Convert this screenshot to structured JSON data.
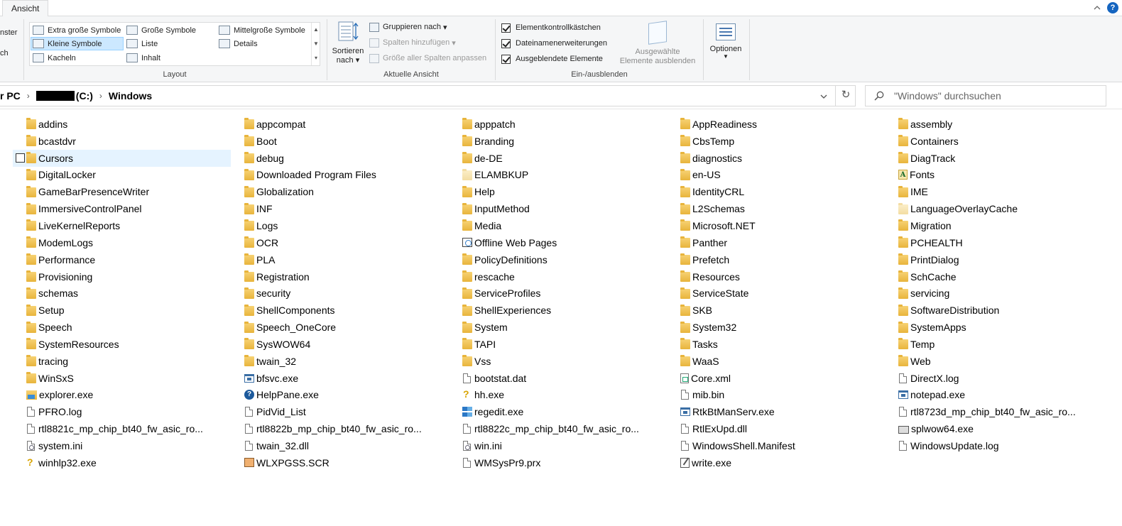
{
  "tabstrip": {
    "active_tab": "Ansicht",
    "help": "?"
  },
  "ribbon": {
    "cut_labels": [
      "nster",
      "ch"
    ],
    "layout": {
      "group_label": "Layout",
      "items": [
        {
          "label": "Extra große Symbole",
          "selected": false
        },
        {
          "label": "Große Symbole",
          "selected": false
        },
        {
          "label": "Mittelgroße Symbole",
          "selected": false
        },
        {
          "label": "Kleine Symbole",
          "selected": true
        },
        {
          "label": "Liste",
          "selected": false
        },
        {
          "label": "Details",
          "selected": false
        },
        {
          "label": "Kacheln",
          "selected": false
        },
        {
          "label": "Inhalt",
          "selected": false
        }
      ]
    },
    "current_view": {
      "group_label": "Aktuelle Ansicht",
      "sort_line1": "Sortieren",
      "sort_line2": "nach",
      "group_by": "Gruppieren nach",
      "add_columns": "Spalten hinzufügen",
      "fit_columns": "Größe aller Spalten anpassen"
    },
    "show_hide": {
      "group_label": "Ein-/ausblenden",
      "checkboxes": [
        {
          "label": "Elementkontrollkästchen",
          "checked": true
        },
        {
          "label": "Dateinamenerweiterungen",
          "checked": true
        },
        {
          "label": "Ausgeblendete Elemente",
          "checked": true
        }
      ],
      "hide_selected_line1": "Ausgewählte",
      "hide_selected_line2": "Elemente ausblenden"
    },
    "options": {
      "label": "Optionen"
    }
  },
  "address": {
    "crumb_pc": "r PC",
    "crumb_drive": "(C:)",
    "crumb_folder": "Windows"
  },
  "search": {
    "placeholder": "\"Windows\" durchsuchen"
  },
  "items": [
    {
      "name": "addins",
      "icon": "folder-icon"
    },
    {
      "name": "appcompat",
      "icon": "folder-icon"
    },
    {
      "name": "apppatch",
      "icon": "folder-icon"
    },
    {
      "name": "AppReadiness",
      "icon": "folder-icon"
    },
    {
      "name": "assembly",
      "icon": "folder-icon"
    },
    {
      "name": "bcastdvr",
      "icon": "folder-icon"
    },
    {
      "name": "Boot",
      "icon": "folder-icon"
    },
    {
      "name": "Branding",
      "icon": "folder-icon"
    },
    {
      "name": "CbsTemp",
      "icon": "folder-icon"
    },
    {
      "name": "Containers",
      "icon": "folder-icon"
    },
    {
      "name": "Cursors",
      "icon": "folder-icon",
      "hover": true
    },
    {
      "name": "debug",
      "icon": "folder-icon"
    },
    {
      "name": "de-DE",
      "icon": "folder-icon"
    },
    {
      "name": "diagnostics",
      "icon": "folder-icon"
    },
    {
      "name": "DiagTrack",
      "icon": "folder-icon"
    },
    {
      "name": "DigitalLocker",
      "icon": "folder-icon"
    },
    {
      "name": "Downloaded Program Files",
      "icon": "folder-icon"
    },
    {
      "name": "ELAMBKUP",
      "icon": "hidden-folder-icon"
    },
    {
      "name": "en-US",
      "icon": "folder-icon"
    },
    {
      "name": "Fonts",
      "icon": "fonts-folder-icon"
    },
    {
      "name": "GameBarPresenceWriter",
      "icon": "folder-icon"
    },
    {
      "name": "Globalization",
      "icon": "folder-icon"
    },
    {
      "name": "Help",
      "icon": "folder-icon"
    },
    {
      "name": "IdentityCRL",
      "icon": "folder-icon"
    },
    {
      "name": "IME",
      "icon": "folder-icon"
    },
    {
      "name": "ImmersiveControlPanel",
      "icon": "folder-icon"
    },
    {
      "name": "INF",
      "icon": "folder-icon"
    },
    {
      "name": "InputMethod",
      "icon": "folder-icon"
    },
    {
      "name": "L2Schemas",
      "icon": "folder-icon"
    },
    {
      "name": "LanguageOverlayCache",
      "icon": "hidden-folder-icon"
    },
    {
      "name": "LiveKernelReports",
      "icon": "folder-icon"
    },
    {
      "name": "Logs",
      "icon": "folder-icon"
    },
    {
      "name": "Media",
      "icon": "folder-icon"
    },
    {
      "name": "Microsoft.NET",
      "icon": "folder-icon"
    },
    {
      "name": "Migration",
      "icon": "folder-icon"
    },
    {
      "name": "ModemLogs",
      "icon": "folder-icon"
    },
    {
      "name": "OCR",
      "icon": "folder-icon"
    },
    {
      "name": "Offline Web Pages",
      "icon": "web-pages-folder-icon"
    },
    {
      "name": "Panther",
      "icon": "folder-icon"
    },
    {
      "name": "PCHEALTH",
      "icon": "folder-icon"
    },
    {
      "name": "Performance",
      "icon": "folder-icon"
    },
    {
      "name": "PLA",
      "icon": "folder-icon"
    },
    {
      "name": "PolicyDefinitions",
      "icon": "folder-icon"
    },
    {
      "name": "Prefetch",
      "icon": "folder-icon"
    },
    {
      "name": "PrintDialog",
      "icon": "folder-icon"
    },
    {
      "name": "Provisioning",
      "icon": "folder-icon"
    },
    {
      "name": "Registration",
      "icon": "folder-icon"
    },
    {
      "name": "rescache",
      "icon": "folder-icon"
    },
    {
      "name": "Resources",
      "icon": "folder-icon"
    },
    {
      "name": "SchCache",
      "icon": "folder-icon"
    },
    {
      "name": "schemas",
      "icon": "folder-icon"
    },
    {
      "name": "security",
      "icon": "folder-icon"
    },
    {
      "name": "ServiceProfiles",
      "icon": "folder-icon"
    },
    {
      "name": "ServiceState",
      "icon": "folder-icon"
    },
    {
      "name": "servicing",
      "icon": "folder-icon"
    },
    {
      "name": "Setup",
      "icon": "folder-icon"
    },
    {
      "name": "ShellComponents",
      "icon": "folder-icon"
    },
    {
      "name": "ShellExperiences",
      "icon": "folder-icon"
    },
    {
      "name": "SKB",
      "icon": "folder-icon"
    },
    {
      "name": "SoftwareDistribution",
      "icon": "folder-icon"
    },
    {
      "name": "Speech",
      "icon": "folder-icon"
    },
    {
      "name": "Speech_OneCore",
      "icon": "folder-icon"
    },
    {
      "name": "System",
      "icon": "folder-icon"
    },
    {
      "name": "System32",
      "icon": "folder-icon"
    },
    {
      "name": "SystemApps",
      "icon": "folder-icon"
    },
    {
      "name": "SystemResources",
      "icon": "folder-icon"
    },
    {
      "name": "SysWOW64",
      "icon": "folder-icon"
    },
    {
      "name": "TAPI",
      "icon": "folder-icon"
    },
    {
      "name": "Tasks",
      "icon": "folder-icon"
    },
    {
      "name": "Temp",
      "icon": "folder-icon"
    },
    {
      "name": "tracing",
      "icon": "folder-icon"
    },
    {
      "name": "twain_32",
      "icon": "folder-icon"
    },
    {
      "name": "Vss",
      "icon": "folder-icon"
    },
    {
      "name": "WaaS",
      "icon": "folder-icon"
    },
    {
      "name": "Web",
      "icon": "folder-icon"
    },
    {
      "name": "WinSxS",
      "icon": "folder-icon"
    },
    {
      "name": "bfsvc.exe",
      "icon": "exe-icon"
    },
    {
      "name": "bootstat.dat",
      "icon": "file-icon"
    },
    {
      "name": "Core.xml",
      "icon": "xml-file-icon"
    },
    {
      "name": "DirectX.log",
      "icon": "text-file-icon"
    },
    {
      "name": "explorer.exe",
      "icon": "explorer-icon"
    },
    {
      "name": "HelpPane.exe",
      "icon": "help-icon"
    },
    {
      "name": "hh.exe",
      "icon": "help-file-icon"
    },
    {
      "name": "mib.bin",
      "icon": "file-icon"
    },
    {
      "name": "notepad.exe",
      "icon": "exe-icon"
    },
    {
      "name": "PFRO.log",
      "icon": "text-file-icon"
    },
    {
      "name": "PidVid_List",
      "icon": "file-icon"
    },
    {
      "name": "regedit.exe",
      "icon": "regedit-icon"
    },
    {
      "name": "RtkBtManServ.exe",
      "icon": "exe-icon"
    },
    {
      "name": "rtl8723d_mp_chip_bt40_fw_asic_ro...",
      "icon": "file-icon"
    },
    {
      "name": "rtl8821c_mp_chip_bt40_fw_asic_ro...",
      "icon": "file-icon"
    },
    {
      "name": "rtl8822b_mp_chip_bt40_fw_asic_ro...",
      "icon": "file-icon"
    },
    {
      "name": "rtl8822c_mp_chip_bt40_fw_asic_ro...",
      "icon": "file-icon"
    },
    {
      "name": "RtlExUpd.dll",
      "icon": "dll-file-icon"
    },
    {
      "name": "splwow64.exe",
      "icon": "printer-icon"
    },
    {
      "name": "system.ini",
      "icon": "ini-file-icon"
    },
    {
      "name": "twain_32.dll",
      "icon": "dll-file-icon"
    },
    {
      "name": "win.ini",
      "icon": "ini-file-icon"
    },
    {
      "name": "WindowsShell.Manifest",
      "icon": "file-icon"
    },
    {
      "name": "WindowsUpdate.log",
      "icon": "text-file-icon"
    },
    {
      "name": "winhlp32.exe",
      "icon": "help-file-icon"
    },
    {
      "name": "WLXPGSS.SCR",
      "icon": "screensaver-icon"
    },
    {
      "name": "WMSysPr9.prx",
      "icon": "file-icon"
    },
    {
      "name": "write.exe",
      "icon": "write-icon"
    }
  ]
}
